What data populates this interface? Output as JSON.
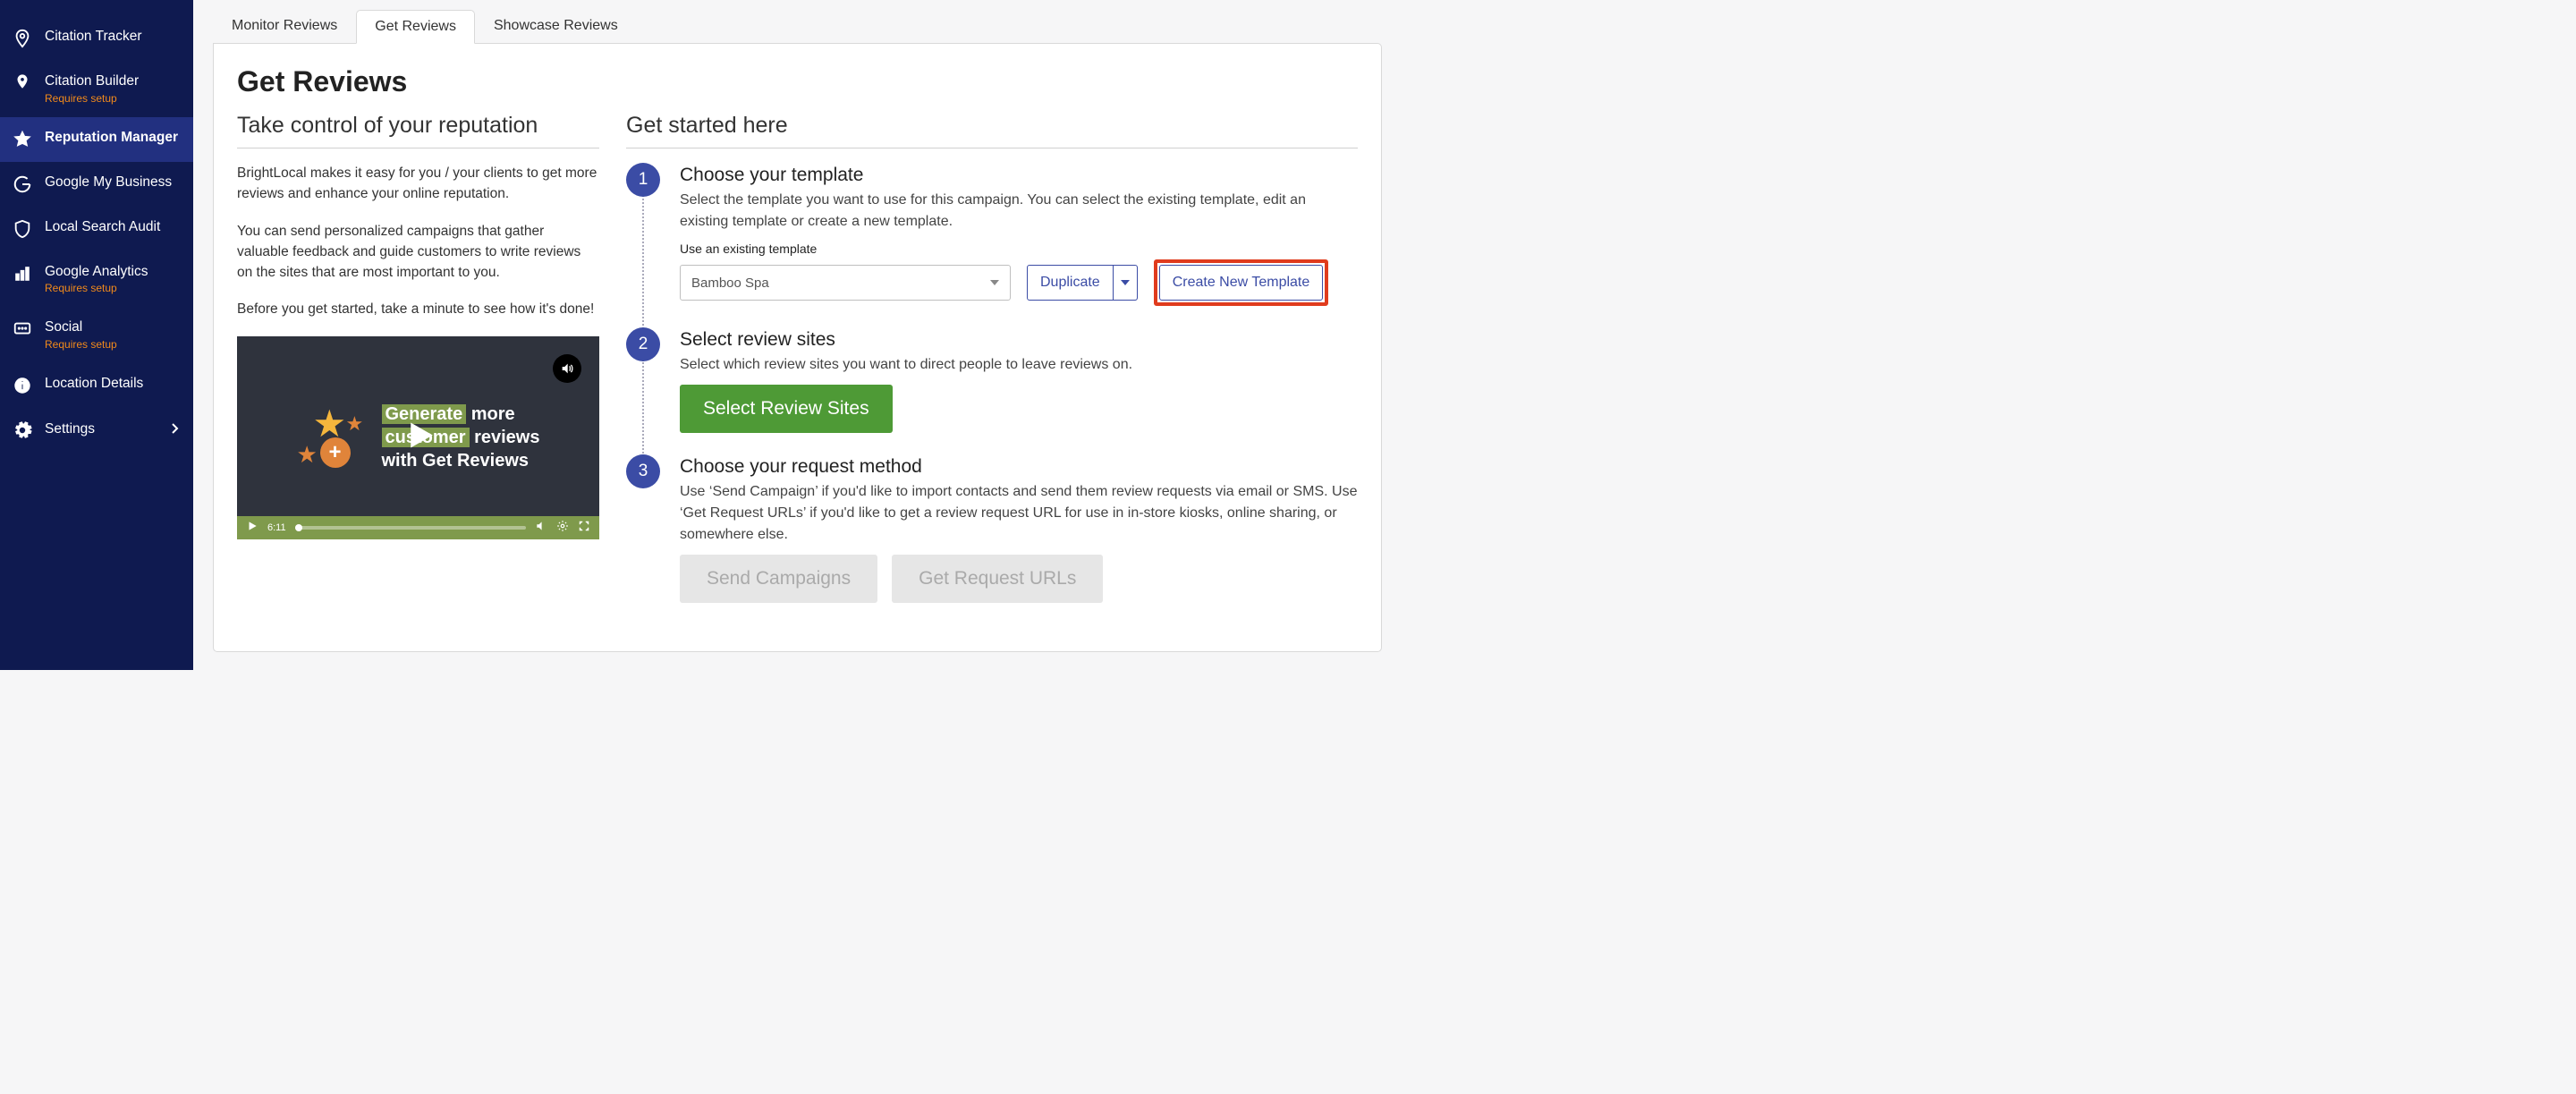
{
  "sidebar": {
    "items": [
      {
        "label": "Citation Tracker"
      },
      {
        "label": "Citation Builder",
        "sub": "Requires setup"
      },
      {
        "label": "Reputation Manager"
      },
      {
        "label": "Google My Business"
      },
      {
        "label": "Local Search Audit"
      },
      {
        "label": "Google Analytics",
        "sub": "Requires setup"
      },
      {
        "label": "Social",
        "sub": "Requires setup"
      },
      {
        "label": "Location Details"
      },
      {
        "label": "Settings"
      }
    ]
  },
  "tabs": [
    "Monitor Reviews",
    "Get Reviews",
    "Showcase Reviews"
  ],
  "page": {
    "title": "Get Reviews",
    "left_heading": "Take control of your reputation",
    "right_heading": "Get started here",
    "para1": "BrightLocal makes it easy for you / your clients to get more reviews and enhance your online reputation.",
    "para2": "You can send personalized campaigns that gather valuable feedback and guide customers to write reviews on the sites that are most important to you.",
    "para3": "Before you get started, take a minute to see how it's done!",
    "video": {
      "line1a": "Generate",
      "line1b": " more",
      "line2a": "customer",
      "line2b": " reviews",
      "line3": "with Get Reviews",
      "time": "6:11"
    }
  },
  "steps": {
    "s1": {
      "num": "1",
      "title": "Choose your template",
      "desc": "Select the template you want to use for this campaign. You can select the existing template, edit an existing template or create a new template.",
      "field_label": "Use an existing template",
      "selected": "Bamboo Spa",
      "duplicate": "Duplicate",
      "create": "Create New Template"
    },
    "s2": {
      "num": "2",
      "title": "Select review sites",
      "desc": "Select which review sites you want to direct people to leave reviews on.",
      "button": "Select Review Sites"
    },
    "s3": {
      "num": "3",
      "title": "Choose your request method",
      "desc": "Use ‘Send Campaign’ if you'd like to import contacts and send them review requests via email or SMS. Use ‘Get Request URLs’ if you'd like to get a review request URL for use in in-store kiosks, online sharing, or somewhere else.",
      "btn_send": "Send Campaigns",
      "btn_urls": "Get Request URLs"
    }
  }
}
